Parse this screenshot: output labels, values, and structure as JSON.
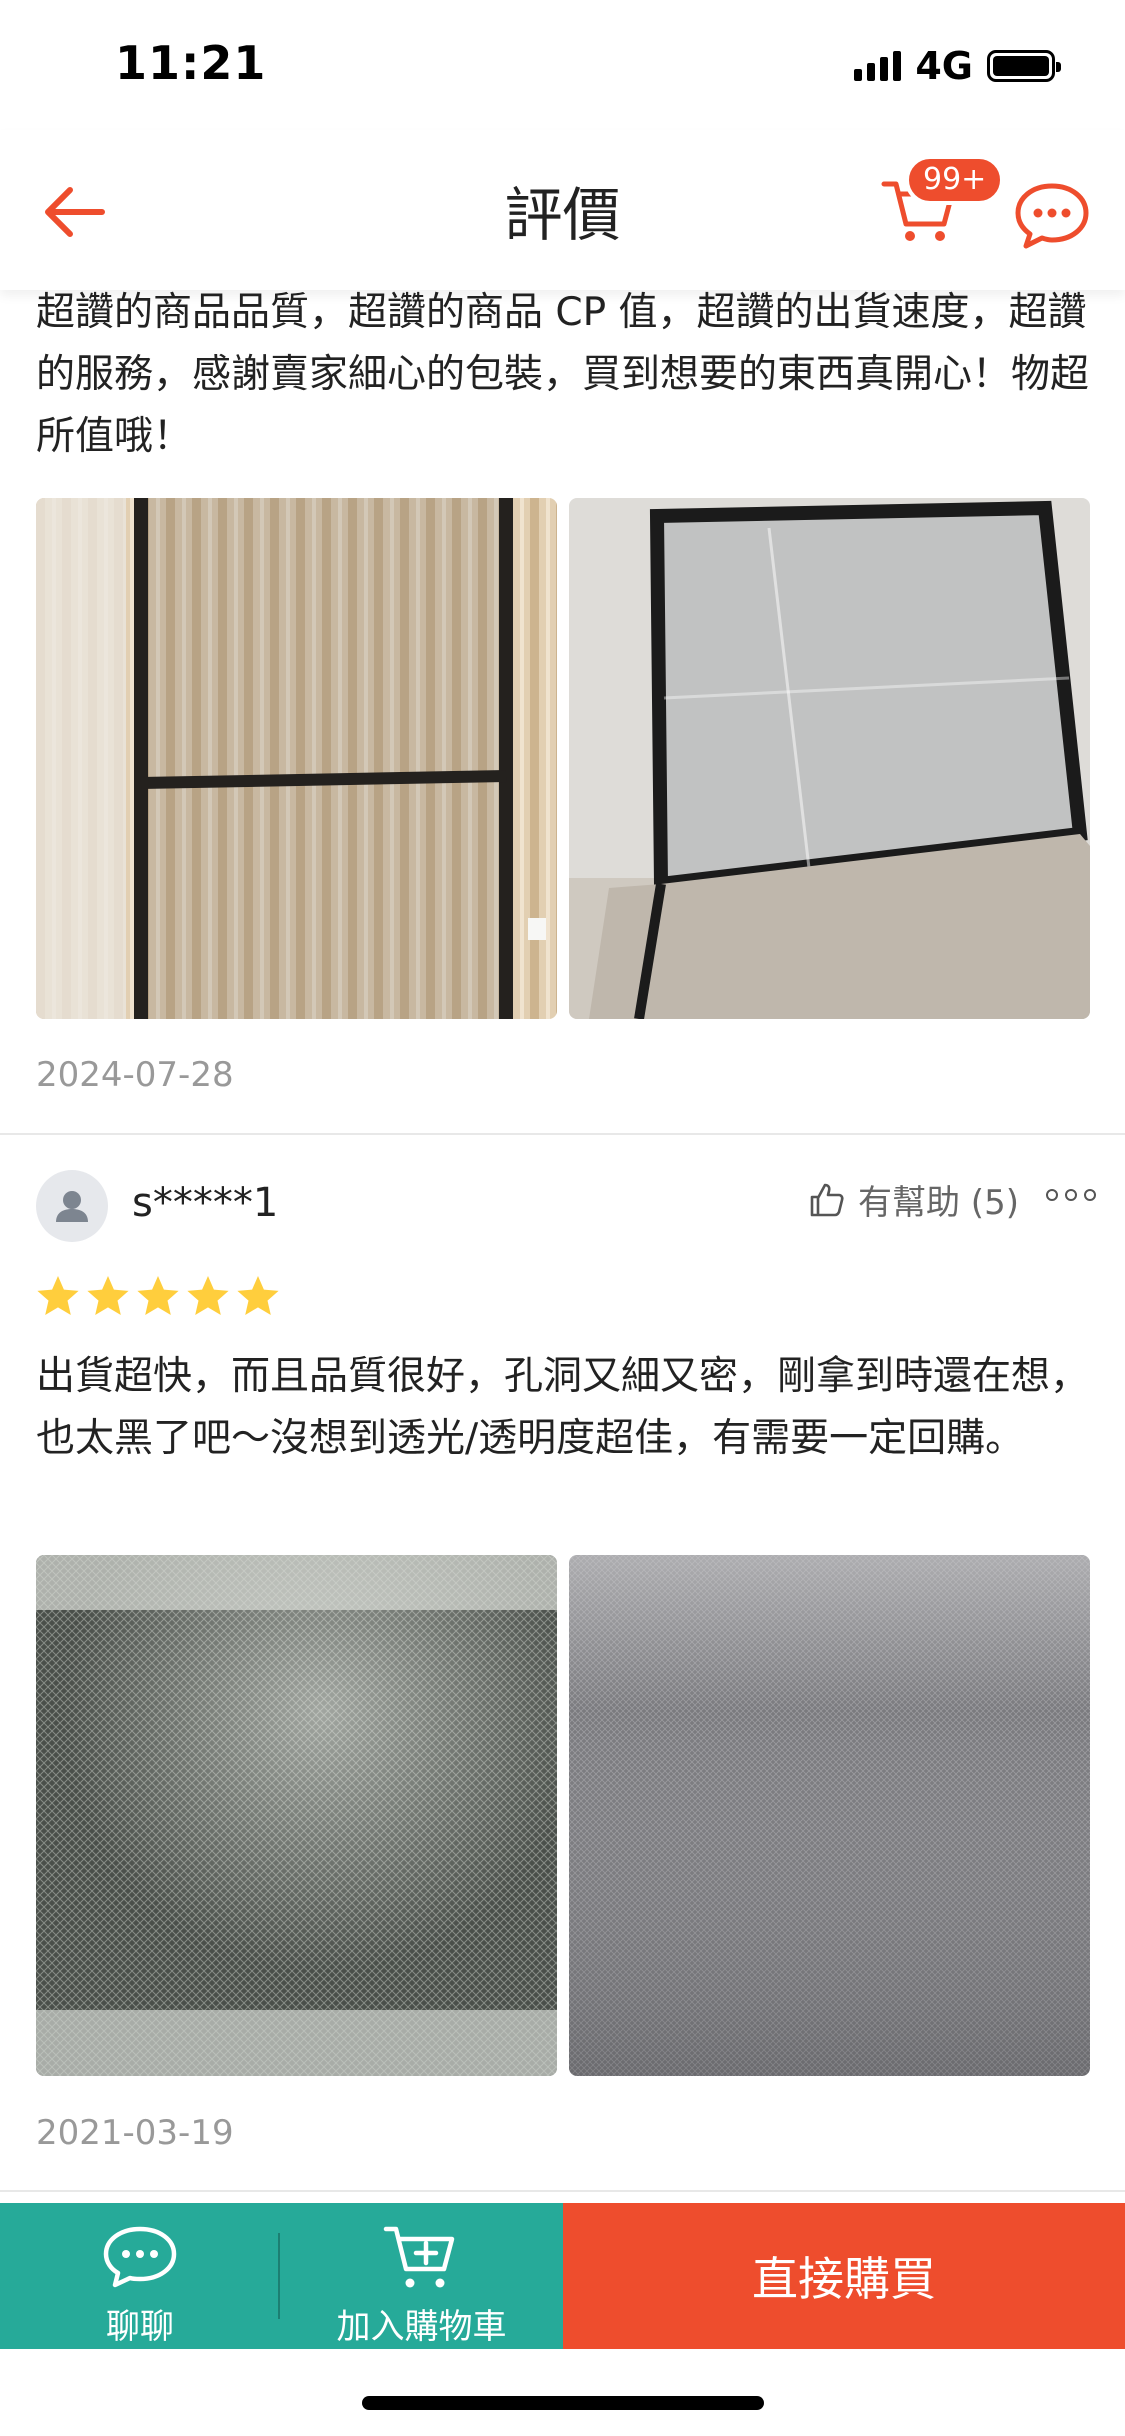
{
  "status_bar": {
    "time": "11:21",
    "network": "4G"
  },
  "nav": {
    "title": "評價",
    "cart_badge": "99+"
  },
  "reviews": [
    {
      "text": "超讚的商品品質，超讚的商品 CP 值，超讚的出貨速度，超讚的服務，感謝賣家細心的包裝，買到想要的東西真開心！物超所值哦！",
      "date": "2024-07-28",
      "photos": [
        "window-screen-frame-photo",
        "screen-panel-on-floor-photo"
      ]
    },
    {
      "username": "s*****1",
      "helpful_label": "有幫助 (5)",
      "rating": 5,
      "text": "出貨超快，而且品質很好，孔洞又細又密，剛拿到時還在想，也太黑了吧～沒想到透光/透明度超佳，有需要一定回購。",
      "date": "2021-03-19",
      "photos": [
        "mesh-closeup-photo-1",
        "mesh-closeup-photo-2"
      ]
    }
  ],
  "bottom_bar": {
    "chat_label": "聊聊",
    "cart_label": "加入購物車",
    "buy_label": "直接購買"
  },
  "colors": {
    "brand": "#ee4d2d",
    "teal": "#26aa99",
    "star": "#ffce3d",
    "muted": "#999999"
  }
}
